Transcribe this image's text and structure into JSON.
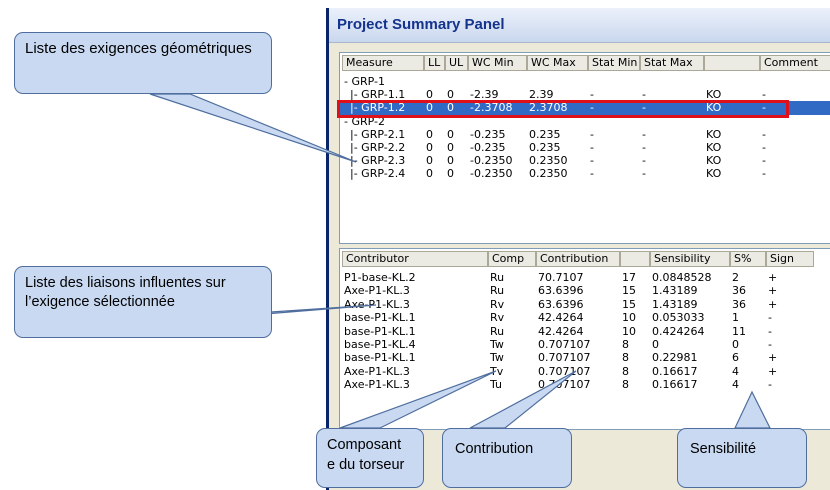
{
  "window": {
    "title": "Project Summary Panel"
  },
  "measure_table": {
    "headers": [
      "Measure",
      "LL",
      "UL",
      "WC Min",
      "WC Max",
      "Stat Min",
      "Stat Max",
      "",
      "Comment"
    ],
    "rows": [
      [
        "- GRP-1",
        "",
        "",
        "",
        "",
        "",
        "",
        "",
        ""
      ],
      [
        "|- GRP-1.1",
        "0",
        "0",
        "-2.39",
        "2.39",
        "-",
        "-",
        "KO",
        "-"
      ],
      [
        "|- GRP-1.2",
        "0",
        "0",
        "-2.3708",
        "2.3708",
        "-",
        "-",
        "KO",
        "-"
      ],
      [
        "- GRP-2",
        "",
        "",
        "",
        "",
        "",
        "",
        "",
        ""
      ],
      [
        "|- GRP-2.1",
        "0",
        "0",
        "-0.235",
        "0.235",
        "-",
        "-",
        "KO",
        "-"
      ],
      [
        "|- GRP-2.2",
        "0",
        "0",
        "-0.235",
        "0.235",
        "-",
        "-",
        "KO",
        "-"
      ],
      [
        "|- GRP-2.3",
        "0",
        "0",
        "-0.2350",
        "0.2350",
        "-",
        "-",
        "KO",
        "-"
      ],
      [
        "|- GRP-2.4",
        "0",
        "0",
        "-0.2350",
        "0.2350",
        "-",
        "-",
        "KO",
        "-"
      ]
    ],
    "selected_row": 2
  },
  "contributor_table": {
    "headers": [
      "Contributor",
      "Comp",
      "Contribution",
      "",
      "Sensibility",
      "S%",
      "Sign"
    ],
    "rows": [
      [
        "P1-base-KL.2",
        "Ru",
        "70.7107",
        "17",
        "0.0848528",
        "2",
        "+"
      ],
      [
        "Axe-P1-KL.3",
        "Ru",
        "63.6396",
        "15",
        "1.43189",
        "36",
        "+"
      ],
      [
        "Axe-P1-KL.3",
        "Rv",
        "63.6396",
        "15",
        "1.43189",
        "36",
        "+"
      ],
      [
        "base-P1-KL.1",
        "Rv",
        "42.4264",
        "10",
        "0.053033",
        "1",
        "-"
      ],
      [
        "base-P1-KL.1",
        "Ru",
        "42.4264",
        "10",
        "0.424264",
        "11",
        "-"
      ],
      [
        "base-P1-KL.4",
        "Tw",
        "0.707107",
        "8",
        "0",
        "0",
        "-"
      ],
      [
        "base-P1-KL.1",
        "Tw",
        "0.707107",
        "8",
        "0.22981",
        "6",
        "+"
      ],
      [
        "Axe-P1-KL.3",
        "Tv",
        "0.707107",
        "8",
        "0.16617",
        "4",
        "+"
      ],
      [
        "Axe-P1-KL.3",
        "Tu",
        "0.707107",
        "8",
        "0.16617",
        "4",
        "-"
      ]
    ]
  },
  "callouts": {
    "measures": "Liste des exigences géométriques",
    "links": "Liste des liaisons influentes sur l’exigence sélectionnée",
    "component": "Composant e du torseur",
    "contribution": "Contribution",
    "sensibility": "Sensibilité"
  },
  "colors": {
    "selection": "#316ac5",
    "highlight_box": "#e0101a",
    "callout_fill": "#c9d9f2",
    "title_text": "#13338d"
  }
}
